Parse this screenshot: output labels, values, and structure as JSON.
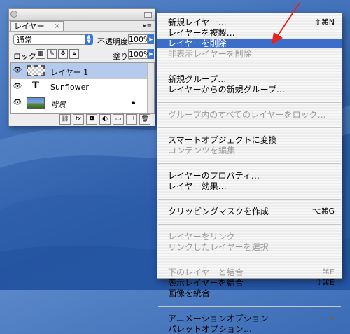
{
  "layers_palette": {
    "tab_title": "レイヤー",
    "tab_close": "×",
    "palette_menu_glyph": "▸≡",
    "blend_mode": "通常",
    "opacity_label": "不透明度：",
    "opacity_value": "100%",
    "lock_label": "ロック：",
    "lock_icons": [
      "lock-transparent-icon",
      "lock-brush-icon",
      "lock-move-icon",
      "lock-all-icon"
    ],
    "fill_label": "塗り：",
    "fill_value": "100%",
    "layers": [
      {
        "name": "レイヤー 1",
        "thumbnail": "transparent-checker",
        "visible": true,
        "selected": true
      },
      {
        "name": "Sunflower",
        "thumbnail": "text-T",
        "thumb_text": "T",
        "visible": true,
        "selected": false
      },
      {
        "name": "背景",
        "thumbnail": "photo",
        "visible": true,
        "selected": false,
        "locked": true
      }
    ],
    "footer_icons": [
      "link-icon",
      "fx-icon",
      "mask-icon",
      "adjustment-icon",
      "folder-icon",
      "new-layer-icon",
      "trash-icon"
    ],
    "footer_fx_text": "fx"
  },
  "context_menu": {
    "groups": [
      [
        {
          "label": "新規レイヤー…",
          "shortcut": "⇧⌘N",
          "disabled": false
        },
        {
          "label": "レイヤーを複製…",
          "shortcut": "",
          "disabled": false
        },
        {
          "label": "レイヤーを削除",
          "shortcut": "",
          "disabled": false,
          "highlighted": true
        },
        {
          "label": "非表示レイヤーを削除",
          "shortcut": "",
          "disabled": true
        }
      ],
      [
        {
          "label": "新規グループ…",
          "shortcut": "",
          "disabled": false
        },
        {
          "label": "レイヤーからの新規グループ…",
          "shortcut": "",
          "disabled": false
        }
      ],
      [
        {
          "label": "グループ内のすべてのレイヤーをロック…",
          "shortcut": "",
          "disabled": true
        }
      ],
      [
        {
          "label": "スマートオブジェクトに変換",
          "shortcut": "",
          "disabled": false
        },
        {
          "label": "コンテンツを編集",
          "shortcut": "",
          "disabled": true
        }
      ],
      [
        {
          "label": "レイヤーのプロパティ…",
          "shortcut": "",
          "disabled": false
        },
        {
          "label": "レイヤー効果…",
          "shortcut": "",
          "disabled": false
        }
      ],
      [
        {
          "label": "クリッピングマスクを作成",
          "shortcut": "⌥⌘G",
          "disabled": false
        }
      ],
      [
        {
          "label": "レイヤーをリンク",
          "shortcut": "",
          "disabled": true
        },
        {
          "label": "リンクしたレイヤーを選択",
          "shortcut": "",
          "disabled": true
        }
      ],
      [
        {
          "label": "下のレイヤーと結合",
          "shortcut": "⌘E",
          "disabled": true
        },
        {
          "label": "表示レイヤーを結合",
          "shortcut": "⇧⌘E",
          "disabled": false
        },
        {
          "label": "画像を統合",
          "shortcut": "",
          "disabled": false
        }
      ],
      [
        {
          "label": "アニメーションオプション",
          "shortcut": "",
          "disabled": false,
          "submenu": true
        },
        {
          "label": "パレットオプション…",
          "shortcut": "",
          "disabled": false
        }
      ]
    ]
  },
  "annotation": {
    "arrow_color": "#e8231b"
  },
  "colors": {
    "highlight": "#3b6ec9",
    "selected_layer": "#b5cbed",
    "desktop": "#3f6fb8"
  }
}
